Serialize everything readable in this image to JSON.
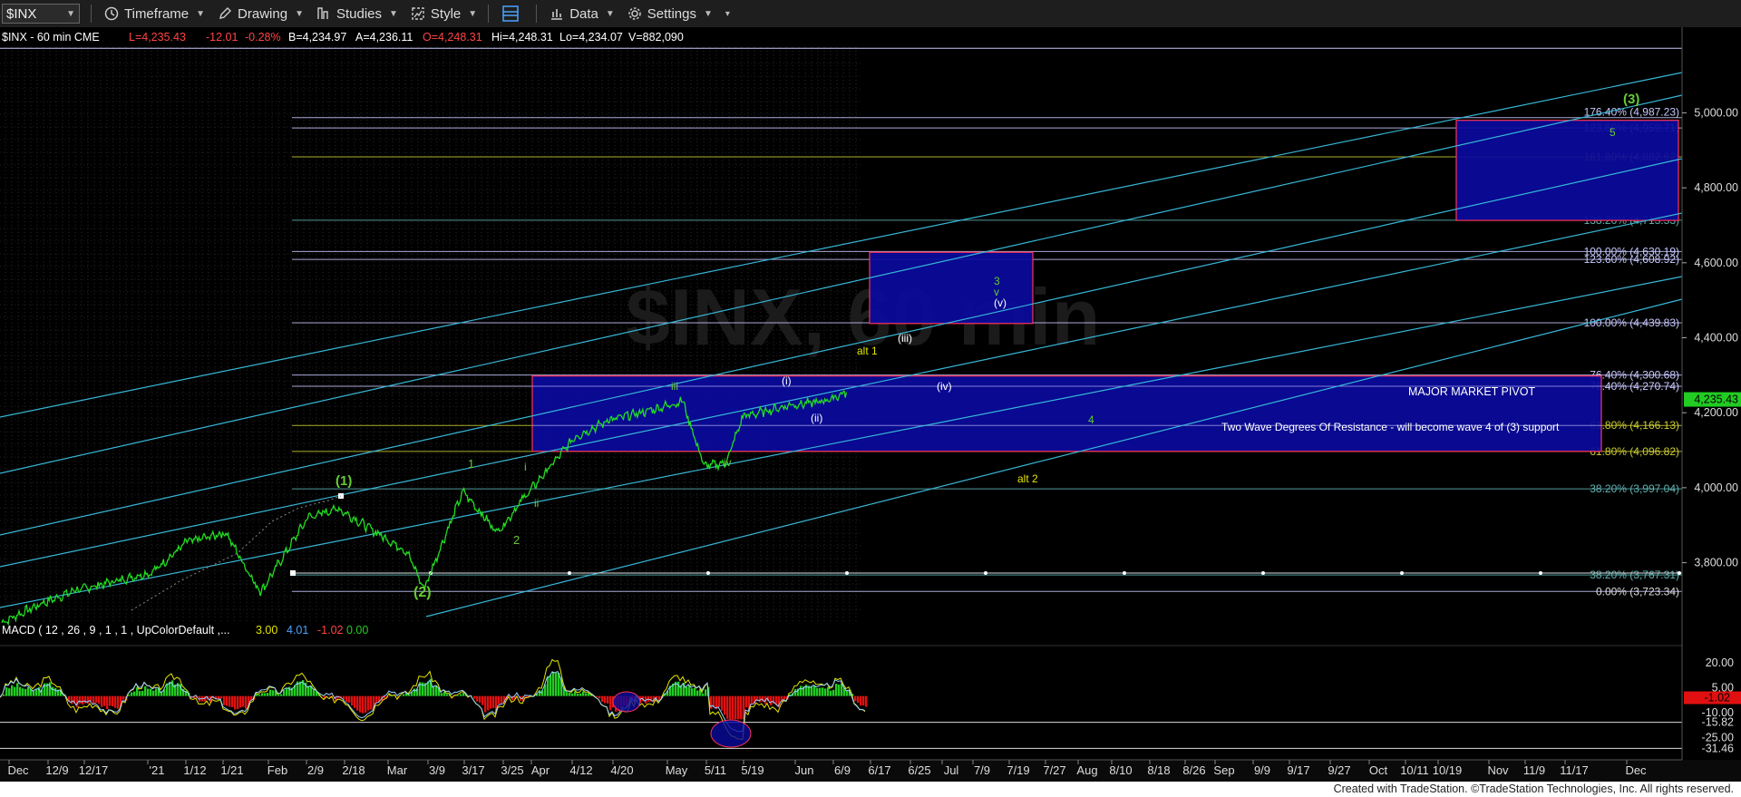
{
  "toolbar": {
    "symbol": "$INX",
    "items": [
      "Timeframe",
      "Drawing",
      "Studies",
      "Style",
      "Data",
      "Settings"
    ]
  },
  "header": {
    "title": "$INX - 60 min  CME",
    "last": "L=4,235.43",
    "change": "-12.01",
    "pct": "-0.28%",
    "bid": "B=4,234.97",
    "ask": "A=4,236.11",
    "open": "O=4,248.31",
    "hi": "Hi=4,248.31",
    "lo": "Lo=4,234.07",
    "vol": "V=882,090"
  },
  "watermark": "$INX, 60 min",
  "macd": {
    "label": "MACD ( 12 , 26 , 9 , 1 , 1 , UpColorDefault ,...",
    "v1": "3.00",
    "v2": "4.01",
    "v3": "-1.02",
    "v4": "0.00"
  },
  "footer": "Created with TradeStation. ©TradeStation Technologies, Inc. All rights reserved.",
  "colors": {
    "price": "#22dd22",
    "fib": "#5fb3b3",
    "channel": "#37b6d6",
    "box_fill": "#0a0a9c",
    "box_border": "#ff3355",
    "yellow": "#e5e500",
    "green": "#66cc33"
  },
  "chart_data": {
    "type": "line",
    "title": "$INX - 60 min",
    "ylim": [
      3620,
      5180
    ],
    "price_axis": [
      "5,000.00",
      "4,800.00",
      "4,600.00",
      "4,400.00",
      "4,200.00",
      "4,000.00",
      "3,800.00"
    ],
    "last_price_tag": "4,235.43",
    "x_tick_labels": [
      "Dec",
      "12/9",
      "12/17",
      "'21",
      "1/12",
      "1/21",
      "Feb",
      "2/9",
      "2/18",
      "Mar",
      "3/9",
      "3/17",
      "3/25",
      "Apr",
      "4/12",
      "4/20",
      "May",
      "5/11",
      "5/19",
      "Jun",
      "6/9",
      "6/17",
      "6/25",
      "Jul",
      "7/9",
      "7/19",
      "7/27",
      "Aug",
      "8/10",
      "8/18",
      "8/26",
      "Sep",
      "9/9",
      "9/17",
      "9/27",
      "Oct",
      "10/11",
      "10/19",
      "Nov",
      "11/9",
      "11/17",
      "Dec"
    ],
    "series": [
      {
        "name": "price",
        "x": [
          "Nov 30",
          "Dec 9",
          "Dec 17",
          "Jan 4",
          "Jan 12",
          "Jan 21",
          "Jan 29",
          "Feb 9",
          "Feb 16",
          "Feb 25",
          "Mar 4",
          "Mar 8",
          "Mar 17",
          "Mar 25",
          "Mar 31",
          "Apr 12",
          "Apr 20",
          "Apr 29",
          "May 7",
          "May 12",
          "May 17",
          "May 21",
          "Jun 1",
          "Jun 9",
          "Jun 14"
        ],
        "values": [
          3640,
          3690,
          3725,
          3775,
          3855,
          3880,
          3720,
          3920,
          3945,
          3880,
          3830,
          3730,
          3990,
          3880,
          3970,
          4135,
          4180,
          4205,
          4230,
          4058,
          4065,
          4190,
          4220,
          4230,
          4255
        ]
      }
    ],
    "fib_levels": [
      {
        "label": "176.40% (4,987.23)",
        "value": 4987.23
      },
      {
        "label": "123.60% (4,959.71)",
        "value": 4959.71
      },
      {
        "label": "161.80% (4,882.62)",
        "value": 4882.62
      },
      {
        "label": "138.20% (4,713.53)",
        "value": 4713.53
      },
      {
        "label": "100.00% (4,630.19)",
        "value": 4630.19
      },
      {
        "label": "123.60% (4,608.92)",
        "value": 4608.92
      },
      {
        "label": "100.00% (4,439.83)",
        "value": 4439.83
      },
      {
        "label": "76.40% (4,300.68)",
        "value": 4300.68
      },
      {
        "label": "76.40% (4,270.74)",
        "value": 4270.74
      },
      {
        "label": "61.80% (4,166.13)",
        "value": 4166.13
      },
      {
        "label": "61.80% (4,096.82)",
        "value": 4096.82
      },
      {
        "label": "38.20% (3,997.04)",
        "value": 3997.04
      },
      {
        "label": "38.20% (3,767.31)",
        "value": 3767.31
      },
      {
        "label": "0.00% (3,723.34)",
        "value": 3723.34
      }
    ],
    "wave_labels": [
      {
        "text": "(1)",
        "color": "green"
      },
      {
        "text": "(2)",
        "color": "green"
      },
      {
        "text": "(3)",
        "color": "green"
      },
      {
        "text": "1",
        "color": "green"
      },
      {
        "text": "2",
        "color": "green"
      },
      {
        "text": "i",
        "color": "green"
      },
      {
        "text": "ii",
        "color": "green"
      },
      {
        "text": "iii",
        "color": "green"
      },
      {
        "text": "iv",
        "color": "green"
      },
      {
        "text": "(i)",
        "color": "white"
      },
      {
        "text": "(ii)",
        "color": "white"
      },
      {
        "text": "(iii)",
        "color": "white"
      },
      {
        "text": "(iv)",
        "color": "white"
      },
      {
        "text": "(v)",
        "color": "white"
      },
      {
        "text": "3",
        "color": "green"
      },
      {
        "text": "v",
        "color": "green"
      },
      {
        "text": "4",
        "color": "green"
      },
      {
        "text": "5",
        "color": "green"
      },
      {
        "text": "alt 1",
        "color": "yellow"
      },
      {
        "text": "alt 2",
        "color": "yellow"
      }
    ],
    "annotations": [
      "MAJOR MARKET PIVOT",
      "Two Wave Degrees Of Resistance - will become wave 4 of (3) support"
    ],
    "macd_axis": [
      "20.00",
      "5.00",
      "-10.00",
      "-15.82",
      "-25.00",
      "-31.46"
    ],
    "macd_last_tag": "-1.02"
  }
}
